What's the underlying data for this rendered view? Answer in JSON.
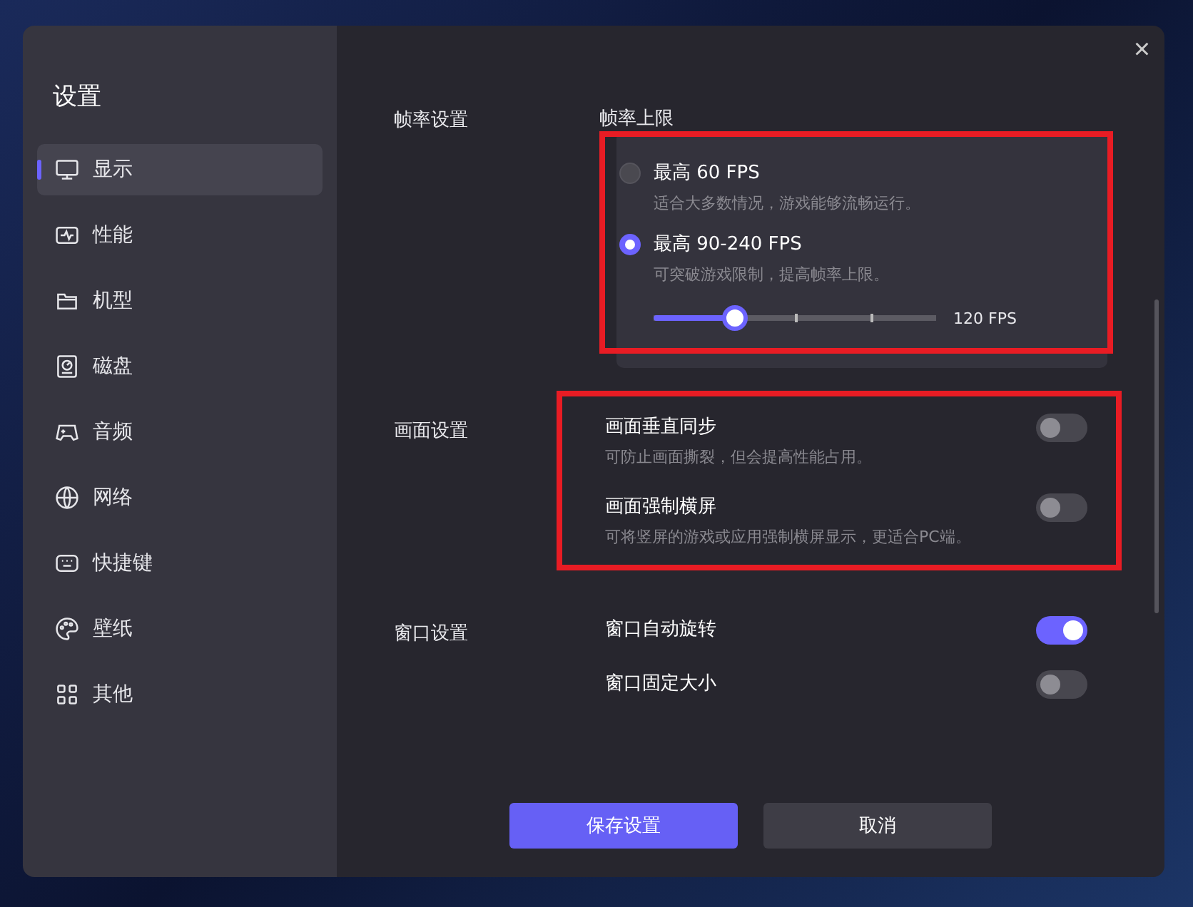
{
  "sidebar": {
    "title": "设置",
    "items": [
      {
        "label": "显示",
        "selected": true
      },
      {
        "label": "性能",
        "selected": false
      },
      {
        "label": "机型",
        "selected": false
      },
      {
        "label": "磁盘",
        "selected": false
      },
      {
        "label": "音频",
        "selected": false
      },
      {
        "label": "网络",
        "selected": false
      },
      {
        "label": "快捷键",
        "selected": false
      },
      {
        "label": "壁纸",
        "selected": false
      },
      {
        "label": "其他",
        "selected": false
      }
    ]
  },
  "close": "×",
  "sections": [
    {
      "kind": "fps",
      "label": "帧率设置",
      "heading": "帧率上限",
      "highlighted": true,
      "options": [
        {
          "title": "最高 60 FPS",
          "description": "适合大多数情况，游戏能够流畅运行。",
          "selected": false
        },
        {
          "title": "最高 90-240 FPS",
          "description": "可突破游戏限制，提高帧率上限。",
          "selected": true,
          "slider": {
            "level": 0.27,
            "reading": "120 FPS"
          }
        }
      ]
    },
    {
      "kind": "toggles",
      "label": "画面设置",
      "highlighted": true,
      "items": [
        {
          "title": "画面垂直同步",
          "description": "可防止画面撕裂，但会提高性能占用。",
          "on": false
        },
        {
          "title": "画面强制横屏",
          "description": "可将竖屏的游戏或应用强制横屏显示，更适合PC端。",
          "on": false
        }
      ]
    },
    {
      "kind": "toggles",
      "label": "窗口设置",
      "highlighted": false,
      "items": [
        {
          "title": "窗口自动旋转",
          "on": true
        },
        {
          "title": "窗口固定大小",
          "on": false
        }
      ]
    }
  ],
  "buttons": [
    {
      "label": "保存设置",
      "kind": "primary"
    },
    {
      "label": "取消",
      "kind": "secondary"
    }
  ]
}
